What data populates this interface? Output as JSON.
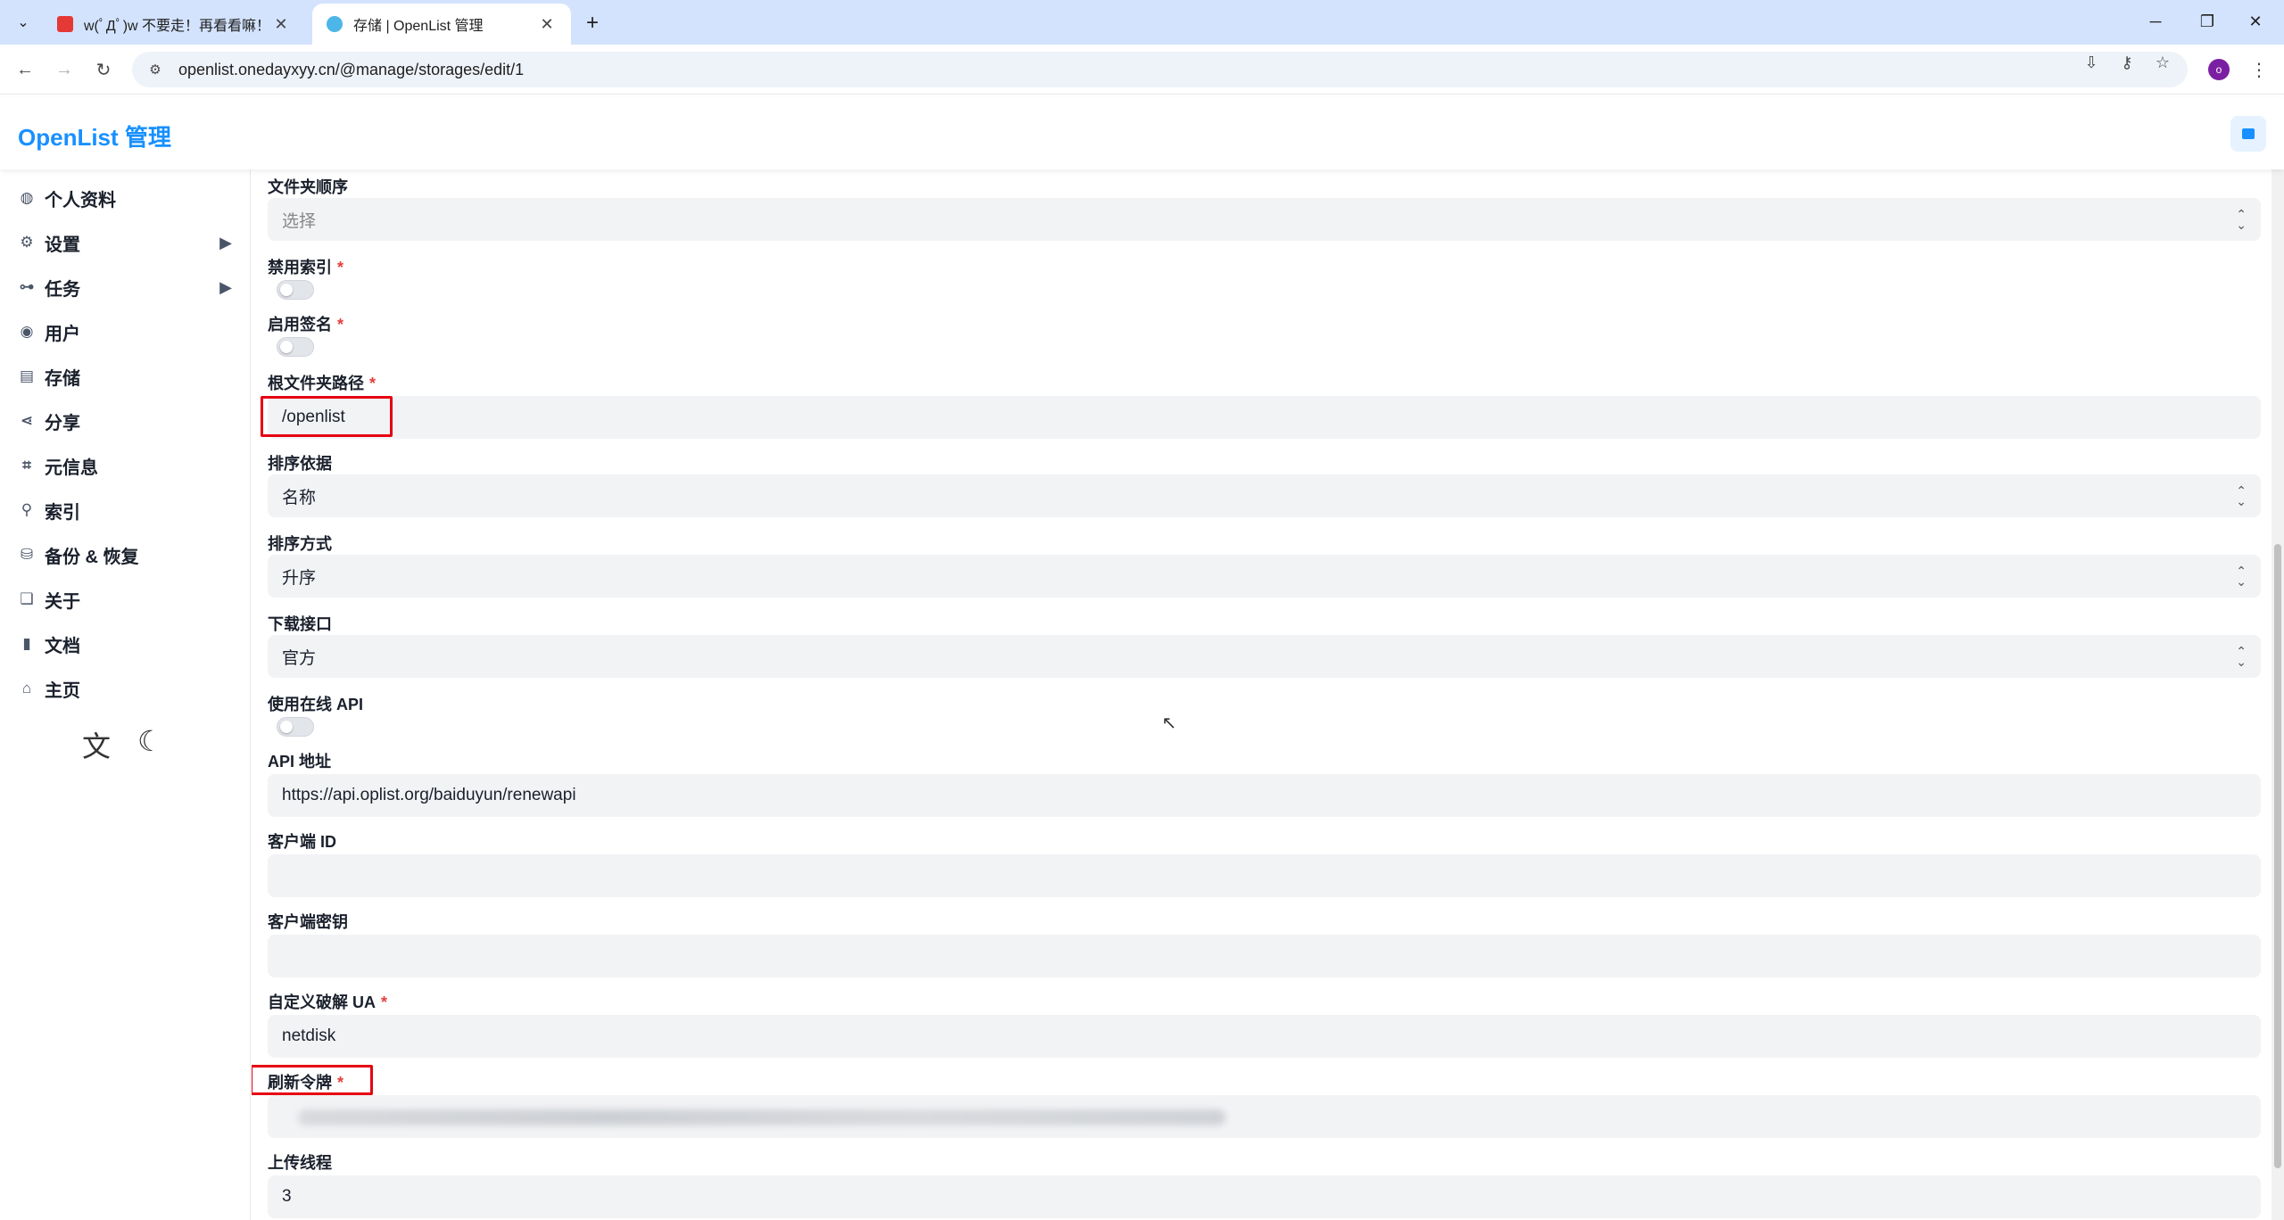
{
  "browser": {
    "tabs": [
      {
        "title": "w(ﾟДﾟ)w 不要走！再看看嘛！",
        "favicon_color": "#e53935"
      },
      {
        "title": "存储 | OpenList 管理",
        "favicon_color": "#4db6e8"
      }
    ],
    "url": "openlist.onedayxyy.cn/@manage/storages/edit/1",
    "profile_initial": "o"
  },
  "app": {
    "brand": "OpenList 管理",
    "accent": "#1890ff"
  },
  "sidebar": {
    "items": [
      {
        "label": "个人资料",
        "icon": "user-profile-icon"
      },
      {
        "label": "设置",
        "icon": "gear-icon",
        "expandable": true
      },
      {
        "label": "任务",
        "icon": "workflow-icon",
        "expandable": true
      },
      {
        "label": "用户",
        "icon": "user-circle-icon"
      },
      {
        "label": "存储",
        "icon": "storage-icon"
      },
      {
        "label": "分享",
        "icon": "share-icon"
      },
      {
        "label": "元信息",
        "icon": "meta-icon"
      },
      {
        "label": "索引",
        "icon": "search-icon"
      },
      {
        "label": "备份 & 恢复",
        "icon": "database-icon"
      },
      {
        "label": "关于",
        "icon": "chat-icon"
      },
      {
        "label": "文档",
        "icon": "book-icon"
      },
      {
        "label": "主页",
        "icon": "home-icon"
      }
    ]
  },
  "form": {
    "folder_order": {
      "label": "文件夹顺序",
      "placeholder": "选择"
    },
    "disable_index": {
      "label": "禁用索引",
      "required": "*",
      "enabled": false
    },
    "enable_sign": {
      "label": "启用签名",
      "required": "*",
      "enabled": false
    },
    "root_path": {
      "label": "根文件夹路径",
      "required": "*",
      "value": "/openlist"
    },
    "order_by": {
      "label": "排序依据",
      "value": "名称"
    },
    "order_direction": {
      "label": "排序方式",
      "value": "升序"
    },
    "download_api": {
      "label": "下载接口",
      "value": "官方"
    },
    "use_online_api": {
      "label": "使用在线 API",
      "enabled": false
    },
    "api_address": {
      "label": "API 地址",
      "value": "https://api.oplist.org/baiduyun/renewapi"
    },
    "client_id": {
      "label": "客户端 ID",
      "value": ""
    },
    "client_secret": {
      "label": "客户端密钥",
      "value": ""
    },
    "custom_ua": {
      "label": "自定义破解 UA",
      "required": "*",
      "value": "netdisk"
    },
    "refresh_token": {
      "label": "刷新令牌",
      "required": "*"
    },
    "upload_threads": {
      "label": "上传线程",
      "value": "3"
    }
  },
  "annotation_color": "#e60012"
}
